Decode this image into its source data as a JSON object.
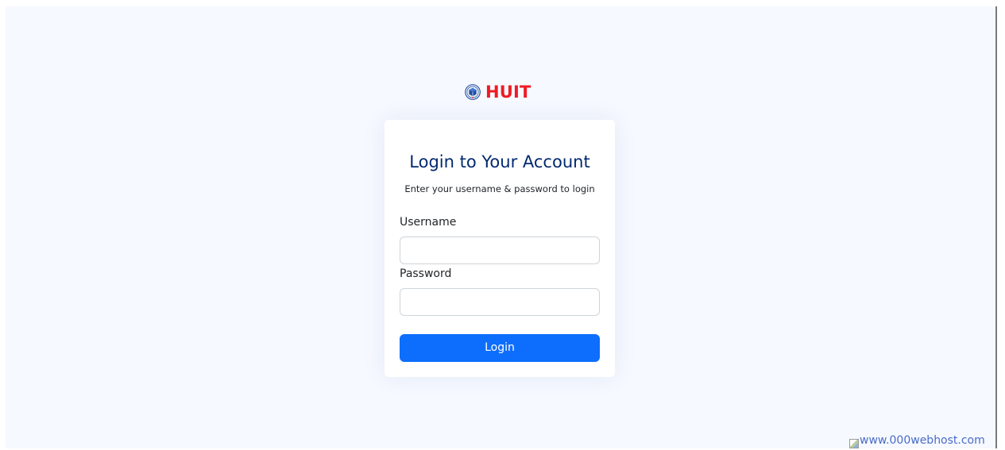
{
  "brand": {
    "name": "HUIT",
    "logo_icon": "university-seal-icon",
    "brand_color": "#ee1b24"
  },
  "login": {
    "title": "Login to Your Account",
    "subtitle": "Enter your username & password to login",
    "username_label": "Username",
    "username_value": "",
    "password_label": "Password",
    "password_value": "",
    "submit_label": "Login"
  },
  "colors": {
    "page_background": "#f6f9ff",
    "title_color": "#012970",
    "primary_button": "#0d6efd"
  },
  "footer": {
    "hosting_badge_alt": "www.000webhost.com",
    "hosting_badge_icon": "broken-image-icon"
  }
}
